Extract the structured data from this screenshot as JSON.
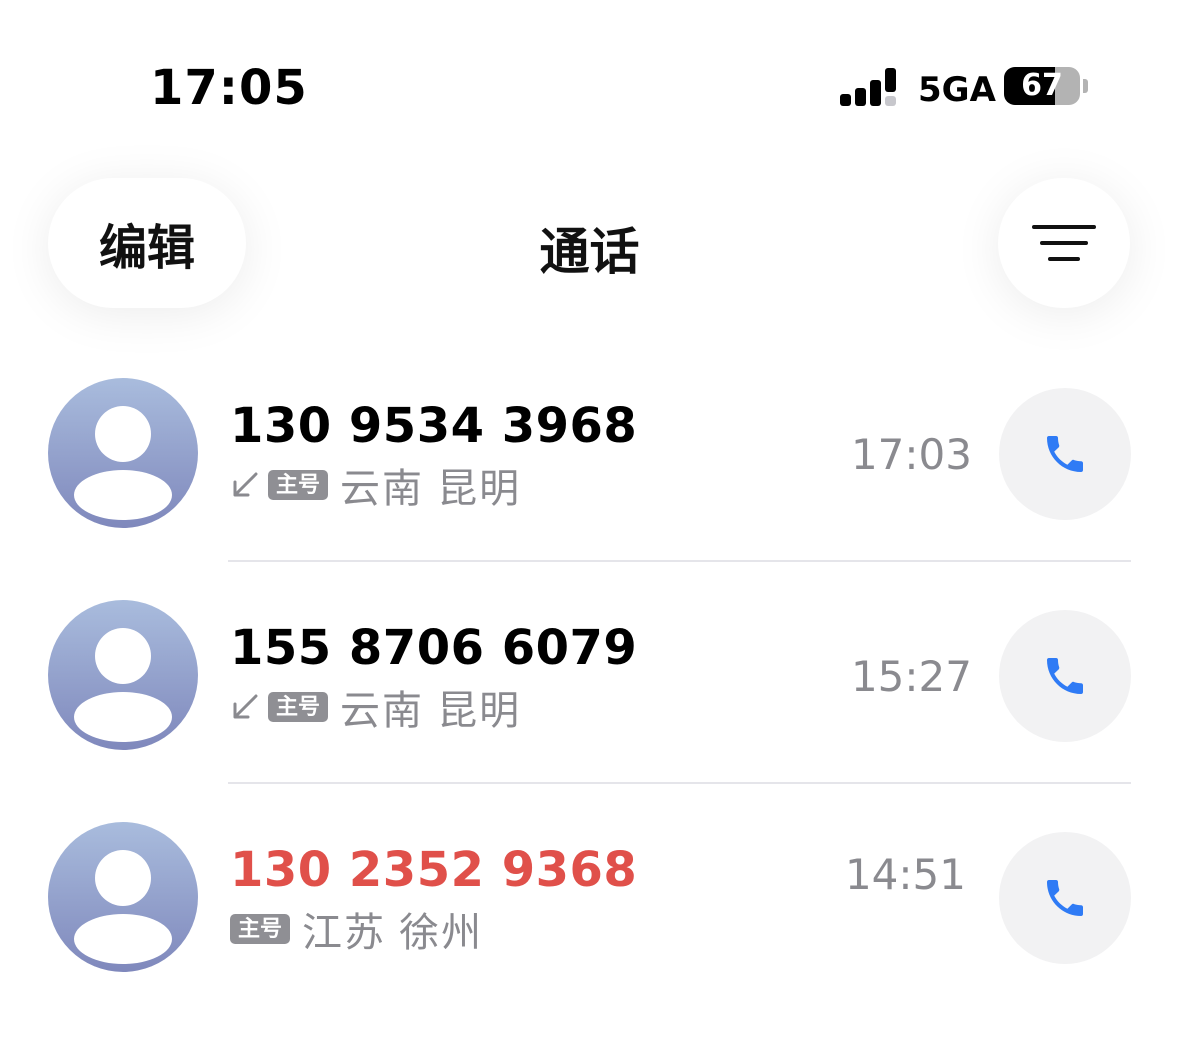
{
  "status_bar": {
    "time": "17:05",
    "network": "5GA",
    "battery_percent": 67,
    "battery_label": "67"
  },
  "nav": {
    "edit_label": "编辑",
    "title": "通话",
    "filter_icon": "filter-lines-icon"
  },
  "colors": {
    "missed": "#e0504a",
    "call_icon": "#2f7bf5",
    "secondary_text": "#8a8a8f",
    "badge_bg": "#8f8f94"
  },
  "calls": [
    {
      "number": "130 9534 3968",
      "direction_icon": "incoming-arrow-icon",
      "badge": "主号",
      "location": "云南 昆明",
      "time": "17:03",
      "missed": false
    },
    {
      "number": "155 8706 6079",
      "direction_icon": "incoming-arrow-icon",
      "badge": "主号",
      "location": "云南 昆明",
      "time": "15:27",
      "missed": false
    },
    {
      "number": "130 2352 9368",
      "badge": "主号",
      "location": "江苏 徐州",
      "time": "14:51",
      "missed": true
    }
  ]
}
